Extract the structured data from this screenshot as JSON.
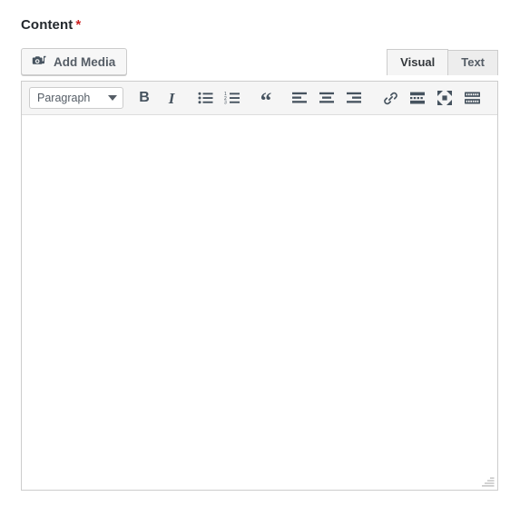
{
  "field": {
    "label": "Content",
    "required_marker": "*",
    "required_color": "#cc2222"
  },
  "media": {
    "add_media_label": "Add Media",
    "add_media_icon": "media-camera-note-icon"
  },
  "editor_tabs": [
    {
      "label": "Visual",
      "active": true
    },
    {
      "label": "Text",
      "active": false
    }
  ],
  "toolbar": {
    "format_select": {
      "value": "Paragraph",
      "caret_icon": "chevron-down-icon"
    },
    "buttons": [
      {
        "name": "bold-button",
        "title": "Bold",
        "glyph": "B"
      },
      {
        "name": "italic-button",
        "title": "Italic",
        "glyph": "I"
      },
      {
        "name": "bulleted-list-button",
        "title": "Bulleted list",
        "glyph": ""
      },
      {
        "name": "numbered-list-button",
        "title": "Numbered list",
        "glyph": ""
      },
      {
        "name": "blockquote-button",
        "title": "Blockquote",
        "glyph": "“"
      },
      {
        "name": "align-left-button",
        "title": "Align left",
        "glyph": ""
      },
      {
        "name": "align-center-button",
        "title": "Align center",
        "glyph": ""
      },
      {
        "name": "align-right-button",
        "title": "Align right",
        "glyph": ""
      },
      {
        "name": "insert-link-button",
        "title": "Insert/edit link",
        "glyph": ""
      },
      {
        "name": "read-more-button",
        "title": "Insert Read More tag",
        "glyph": ""
      },
      {
        "name": "fullscreen-button",
        "title": "Distraction-free writing mode",
        "glyph": ""
      },
      {
        "name": "toolbar-toggle-button",
        "title": "Toolbar Toggle",
        "glyph": ""
      }
    ]
  },
  "content": {
    "body_text": "",
    "placeholder": ""
  },
  "statusbar": {
    "path": "",
    "resize_handle": "resize-grip-icon"
  },
  "colors": {
    "icon": "#46535f",
    "border": "#cccccc",
    "toolbar_bg": "#f5f5f5",
    "tab_inactive_bg": "#ededed",
    "button_bg": "#f7f7f7",
    "label_text": "#23282d"
  }
}
